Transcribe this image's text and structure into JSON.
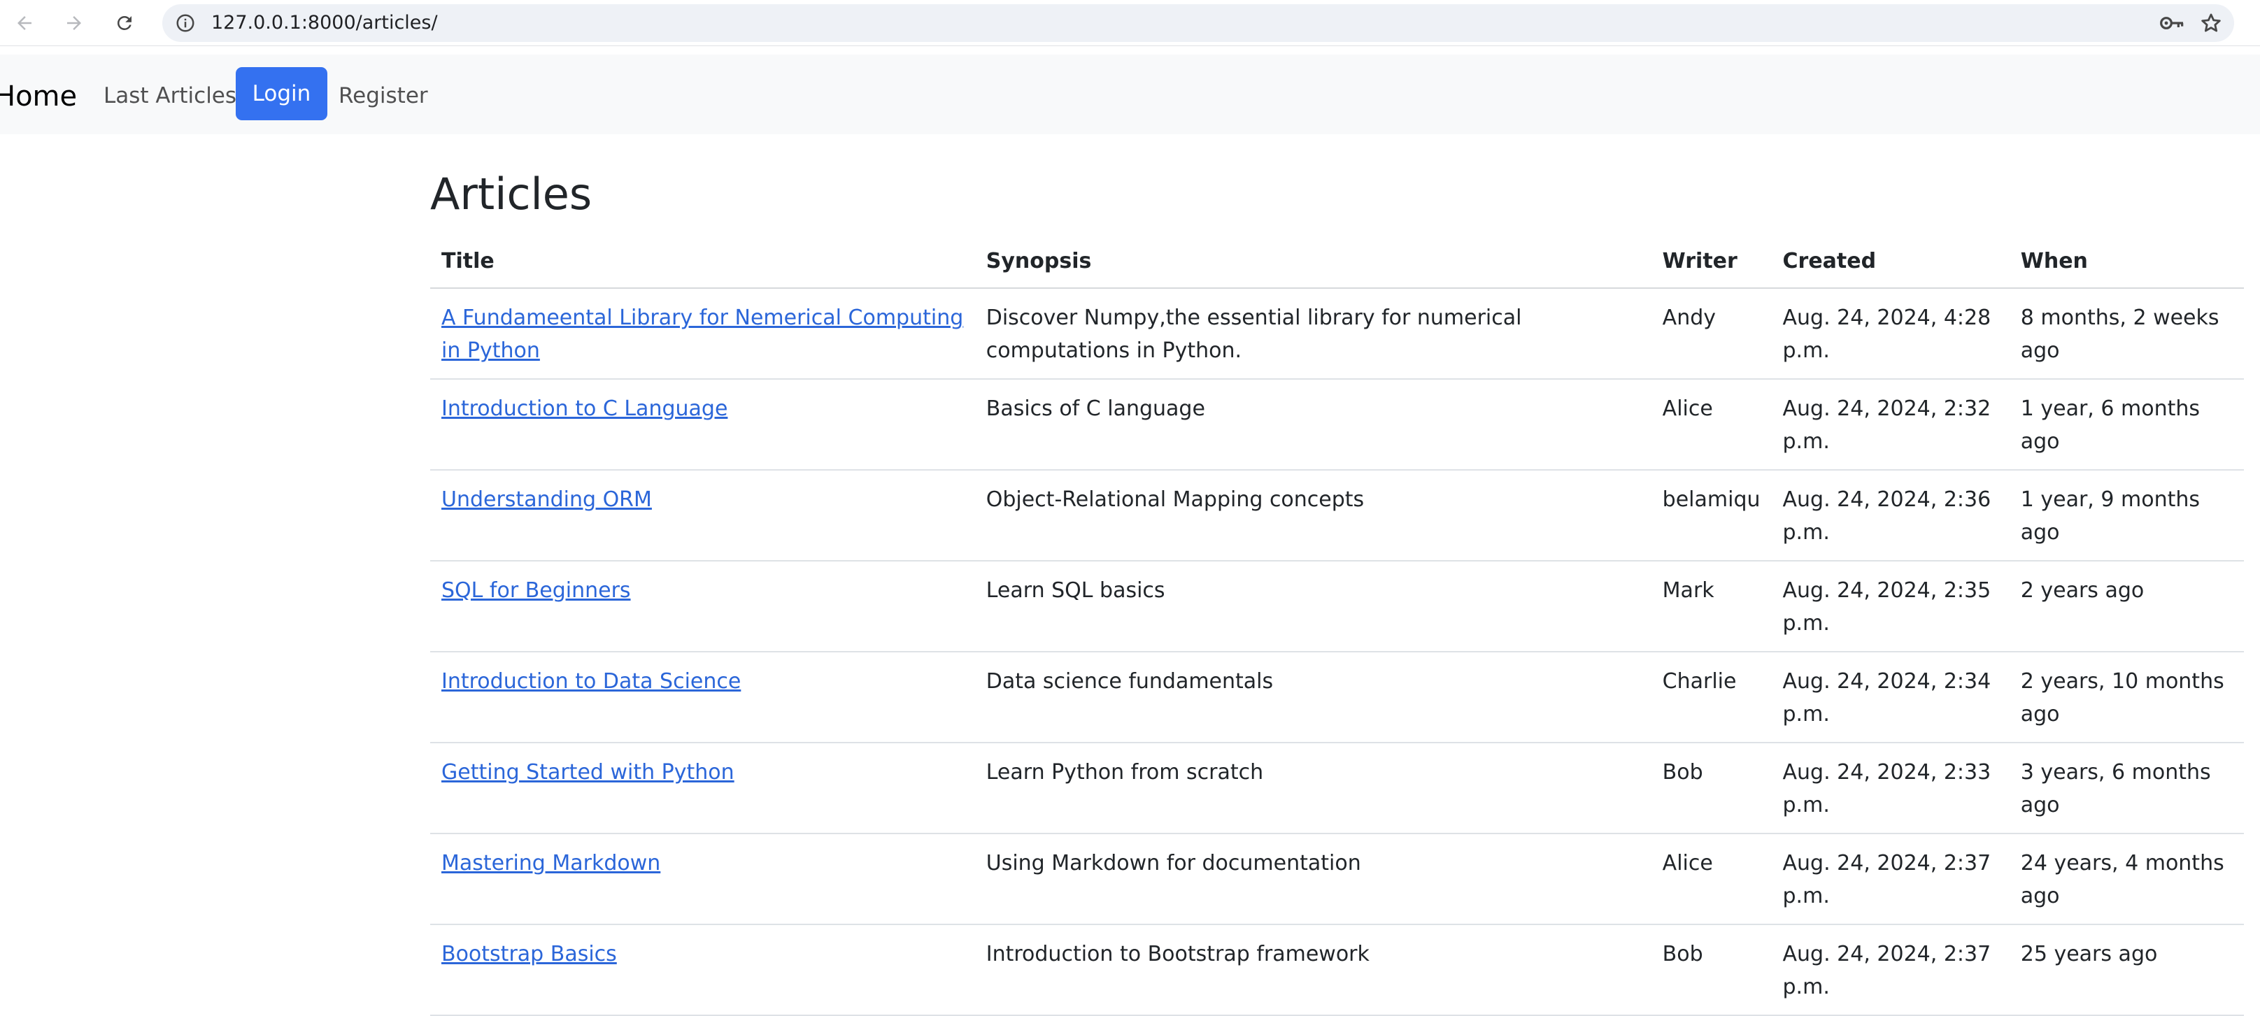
{
  "browser": {
    "url": "127.0.0.1:8000/articles/",
    "icons": [
      "back-arrow-icon",
      "forward-arrow-icon",
      "reload-icon",
      "site-info-icon",
      "password-key-icon",
      "bookmark-star-icon"
    ]
  },
  "navbar": {
    "brand": "Home",
    "links": [
      "Last Articles",
      "Login",
      "Register"
    ],
    "active": "Login",
    "colors": {
      "background": "#f8f9fa",
      "active_bg": "#3471f0"
    }
  },
  "page": {
    "title": "Articles"
  },
  "table": {
    "headers": [
      "Title",
      "Synopsis",
      "Writer",
      "Created",
      "When"
    ],
    "rows": [
      [
        "A Fundameental Library for Nemerical Computing in Python",
        "Discover Numpy,the essential library for numerical computations in Python.",
        "Andy",
        "Aug. 24, 2024, 4:28 p.m.",
        "8 months, 2 weeks ago"
      ],
      [
        "Introduction to C Language",
        "Basics of C language",
        "Alice",
        "Aug. 24, 2024, 2:32 p.m.",
        "1 year, 6 months ago"
      ],
      [
        "Understanding ORM",
        "Object-Relational Mapping concepts",
        "belamiqu",
        "Aug. 24, 2024, 2:36 p.m.",
        "1 year, 9 months ago"
      ],
      [
        "SQL for Beginners",
        "Learn SQL basics",
        "Mark",
        "Aug. 24, 2024, 2:35 p.m.",
        "2 years ago"
      ],
      [
        "Introduction to Data Science",
        "Data science fundamentals",
        "Charlie",
        "Aug. 24, 2024, 2:34 p.m.",
        "2 years, 10 months ago"
      ],
      [
        "Getting Started with Python",
        "Learn Python from scratch",
        "Bob",
        "Aug. 24, 2024, 2:33 p.m.",
        "3 years, 6 months ago"
      ],
      [
        "Mastering Markdown",
        "Using Markdown for documentation",
        "Alice",
        "Aug. 24, 2024, 2:37 p.m.",
        "24 years, 4 months ago"
      ],
      [
        "Bootstrap Basics",
        "Introduction to Bootstrap framework",
        "Bob",
        "Aug. 24, 2024, 2:37 p.m.",
        "25 years ago"
      ]
    ],
    "link_color": "#2b66d9"
  }
}
